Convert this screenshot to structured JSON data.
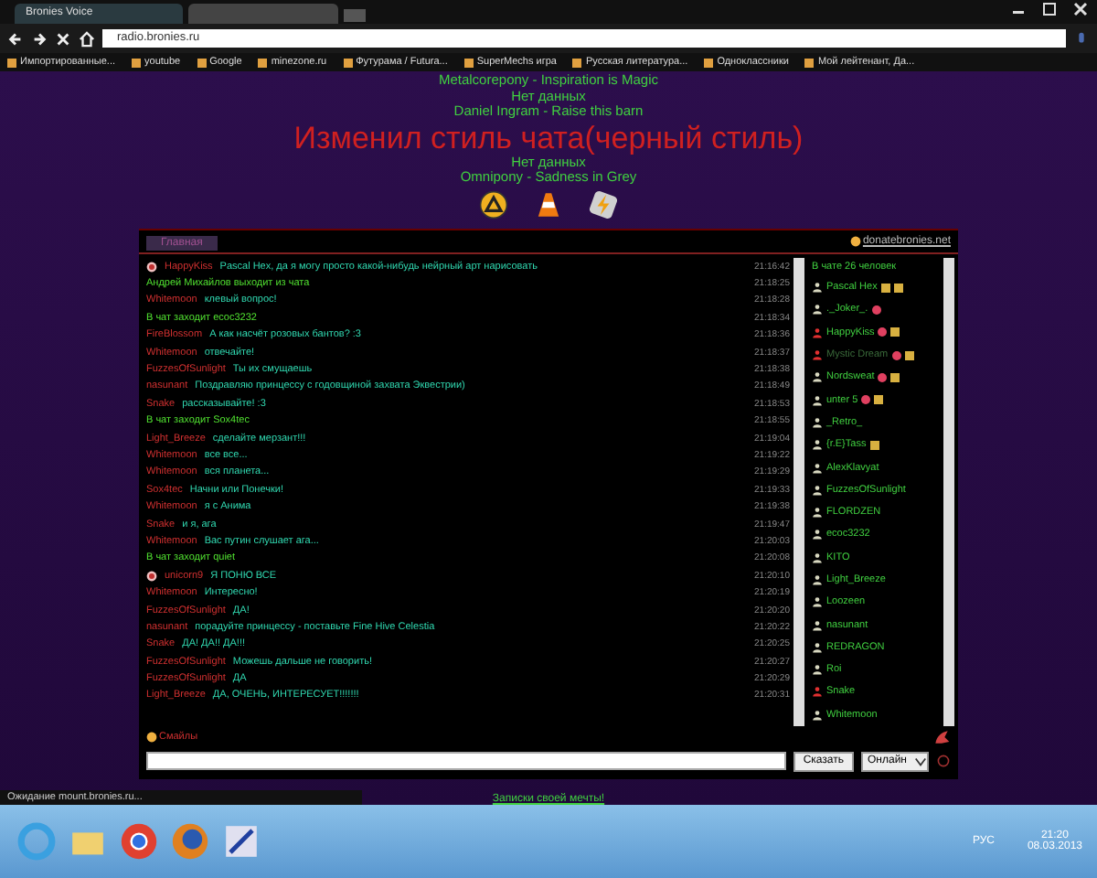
{
  "browser": {
    "tabs": [
      {
        "title": "Bronies Voice",
        "selected": true
      },
      {
        "selected": false
      }
    ],
    "address": "radio.bronies.ru",
    "bookmarks": [
      {
        "label": "Импортированные..."
      },
      {
        "label": "youtube"
      },
      {
        "label": "Google"
      },
      {
        "label": "minezone.ru"
      },
      {
        "label": "Футурама / Futura..."
      },
      {
        "label": "SuperMechs игра"
      },
      {
        "label": "Русская литература..."
      },
      {
        "label": "Одноклассники"
      },
      {
        "label": "Мой лейтенант, Да..."
      }
    ]
  },
  "header": {
    "lines_top": [
      "Metalcorepony - Inspiration is Magic",
      "Нет данных",
      "Daniel Ingram - Raise this barn"
    ],
    "banner": "Изменил стиль чата(черный стиль)",
    "lines_bottom": [
      "Нет данных",
      "Omnipony - Sadness in Grey"
    ]
  },
  "chat": {
    "tab": "Главная",
    "link": "donatebronies.net",
    "messages": [
      {
        "kind": "user",
        "avatar": true,
        "author": "HappyKiss",
        "text": "Pascal Hex, да я могу просто какой-нибудь нейрный арт нарисовать",
        "time": "21:16:42"
      },
      {
        "kind": "system",
        "text": "Андрей Михайлов выходит из чата",
        "time": "21:18:25"
      },
      {
        "kind": "user",
        "avatar": false,
        "author": "Whitemoon",
        "text": "клевый вопрос!",
        "time": "21:18:28"
      },
      {
        "kind": "system",
        "text": "В чат заходит ecoc3232",
        "time": "21:18:34"
      },
      {
        "kind": "user",
        "avatar": false,
        "author": "FireBlossom",
        "text": "А как насчёт розовых бантов? :3",
        "time": "21:18:36"
      },
      {
        "kind": "user",
        "avatar": false,
        "author": "Whitemoon",
        "text": "отвечайте!",
        "time": "21:18:37"
      },
      {
        "kind": "user",
        "avatar": false,
        "author": "FuzzesOfSunlight",
        "text": "Ты их смущаешь",
        "time": "21:18:38"
      },
      {
        "kind": "user",
        "avatar": false,
        "author": "nasunant",
        "text": "Поздравляю принцессу с годовщиной захвата Эквестрии)",
        "time": "21:18:49"
      },
      {
        "kind": "user",
        "avatar": false,
        "author": "Snake",
        "text": "рассказывайте! :3",
        "time": "21:18:53"
      },
      {
        "kind": "system",
        "text": "В чат заходит Sox4tec",
        "time": "21:18:55"
      },
      {
        "kind": "user",
        "avatar": false,
        "author": "Light_Breeze",
        "text": "сделайте мерзант!!!",
        "time": "21:19:04"
      },
      {
        "kind": "user",
        "avatar": false,
        "author": "Whitemoon",
        "text": "все все...",
        "time": "21:19:22"
      },
      {
        "kind": "user",
        "avatar": false,
        "author": "Whitemoon",
        "text": "вся планета...",
        "time": "21:19:29"
      },
      {
        "kind": "user",
        "avatar": false,
        "author": "Sox4tec",
        "text": "Начни или Понечки!",
        "time": "21:19:33"
      },
      {
        "kind": "user",
        "avatar": false,
        "author": "Whitemoon",
        "text": "я с Анима",
        "time": "21:19:38"
      },
      {
        "kind": "user",
        "avatar": false,
        "author": "Snake",
        "text": "и я, ага",
        "time": "21:19:47"
      },
      {
        "kind": "user",
        "avatar": false,
        "author": "Whitemoon",
        "text": "Вас путин слушает ага...",
        "time": "21:20:03"
      },
      {
        "kind": "system",
        "text": "В чат заходит quiet",
        "time": "21:20:08"
      },
      {
        "kind": "user",
        "avatar": true,
        "author": "unicorn9",
        "text": "Я ПОНЮ ВСЕ",
        "time": "21:20:10"
      },
      {
        "kind": "user",
        "avatar": false,
        "author": "Whitemoon",
        "text": "Интересно!",
        "time": "21:20:19"
      },
      {
        "kind": "user",
        "avatar": false,
        "author": "FuzzesOfSunlight",
        "text": "ДА!",
        "time": "21:20:20"
      },
      {
        "kind": "user",
        "avatar": false,
        "author": "nasunant",
        "text": "порадуйте принцессу - поставьте Fine Hive Celestia",
        "time": "21:20:22"
      },
      {
        "kind": "user",
        "avatar": false,
        "author": "Snake",
        "text": "ДА! ДА!! ДА!!!",
        "time": "21:20:25"
      },
      {
        "kind": "user",
        "avatar": false,
        "author": "FuzzesOfSunlight",
        "text": "Можешь дальше не говорить!",
        "time": "21:20:27"
      },
      {
        "kind": "user",
        "avatar": false,
        "author": "FuzzesOfSunlight",
        "text": "ДА",
        "time": "21:20:29"
      },
      {
        "kind": "user",
        "avatar": false,
        "author": "Light_Breeze",
        "text": "ДА, ОЧЕНЬ, ИНТЕРЕСУЕТ!!!!!!!",
        "time": "21:20:31"
      }
    ],
    "users_header": "В чате 26 человек",
    "users": [
      {
        "name": "Pascal Hex",
        "color": "#d8d8c0",
        "dimmed": false,
        "badges": [
          {
            "kind": "gift"
          },
          {
            "kind": "gift"
          }
        ]
      },
      {
        "name": "._Joker_.",
        "color": "#d8d8c0",
        "dimmed": false,
        "badges": [
          {
            "kind": "heart"
          }
        ]
      },
      {
        "name": "HappyKiss",
        "color": "#e03030",
        "dimmed": false,
        "badges": [
          {
            "kind": "heart"
          },
          {
            "kind": "gift"
          }
        ]
      },
      {
        "name": "Mystic Dream",
        "color": "#e03030",
        "dimmed": true,
        "badges": [
          {
            "kind": "heart"
          },
          {
            "kind": "gift"
          }
        ]
      },
      {
        "name": "Nordsweat",
        "color": "#d8d8c0",
        "dimmed": false,
        "badges": [
          {
            "kind": "heart"
          },
          {
            "kind": "gift"
          }
        ]
      },
      {
        "name": "unter 5",
        "color": "#d8d8c0",
        "dimmed": false,
        "badges": [
          {
            "kind": "heart"
          },
          {
            "kind": "gift"
          }
        ]
      },
      {
        "name": "_Retro_",
        "color": "#d8d8c0",
        "dimmed": false
      },
      {
        "name": "{r.E}Tass",
        "color": "#d8d8c0",
        "dimmed": false,
        "badges": [
          {
            "kind": "gift"
          }
        ]
      },
      {
        "name": "AlexKlavyat",
        "color": "#d8d8c0",
        "dimmed": false
      },
      {
        "name": "FuzzesOfSunlight",
        "color": "#d8d8c0",
        "dimmed": false
      },
      {
        "name": "FLORDZEN",
        "color": "#d8d8c0",
        "dimmed": false
      },
      {
        "name": "ecoc3232",
        "color": "#d8d8c0",
        "dimmed": false
      },
      {
        "name": "KITO",
        "color": "#d8d8c0",
        "dimmed": false
      },
      {
        "name": "Light_Breeze",
        "color": "#d8d8c0",
        "dimmed": false
      },
      {
        "name": "Loozeen",
        "color": "#d8d8c0",
        "dimmed": false
      },
      {
        "name": "nasunant",
        "color": "#d8d8c0",
        "dimmed": false
      },
      {
        "name": "REDRAGON",
        "color": "#d8d8c0",
        "dimmed": false
      },
      {
        "name": "Roi",
        "color": "#d8d8c0",
        "dimmed": false
      },
      {
        "name": "Snake",
        "color": "#e03030",
        "dimmed": false
      },
      {
        "name": "Whitemoon",
        "color": "#d8d8c0",
        "dimmed": false
      }
    ],
    "smileys": "Смайлы",
    "send_button": "Сказать",
    "status_select": "Онлайн"
  },
  "status_text": "Ожидание mount.bronies.ru...",
  "footer_text": "Записки своей мечты!",
  "taskbar": {
    "language": "РУС",
    "time": "21:20",
    "date": "08.03.2013"
  }
}
